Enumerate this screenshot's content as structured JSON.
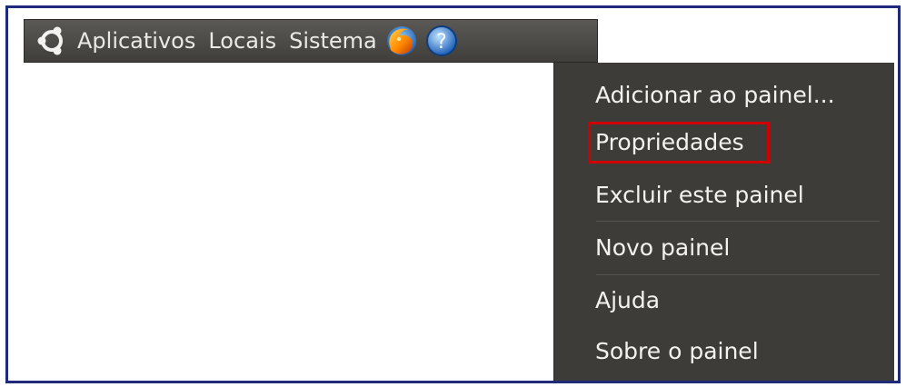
{
  "panel": {
    "menus": [
      {
        "label": "Aplicativos"
      },
      {
        "label": "Locais"
      },
      {
        "label": "Sistema"
      }
    ],
    "icons": {
      "logo": "ubuntu-logo-icon",
      "browser": "firefox-icon",
      "help": "help-icon"
    }
  },
  "context_menu": {
    "items": [
      {
        "label": "Adicionar ao painel..."
      },
      {
        "label": "Propriedades",
        "highlighted": true
      },
      {
        "label": "Excluir este painel"
      },
      {
        "label": "Novo painel"
      },
      {
        "label": "Ajuda"
      },
      {
        "label": "Sobre o painel"
      }
    ]
  },
  "colors": {
    "panel_bg": "#4d4c48",
    "menu_bg": "#3d3c38",
    "text": "#f2f2f0",
    "highlight_border": "#d00000",
    "frame_border": "#1f2b7a"
  }
}
